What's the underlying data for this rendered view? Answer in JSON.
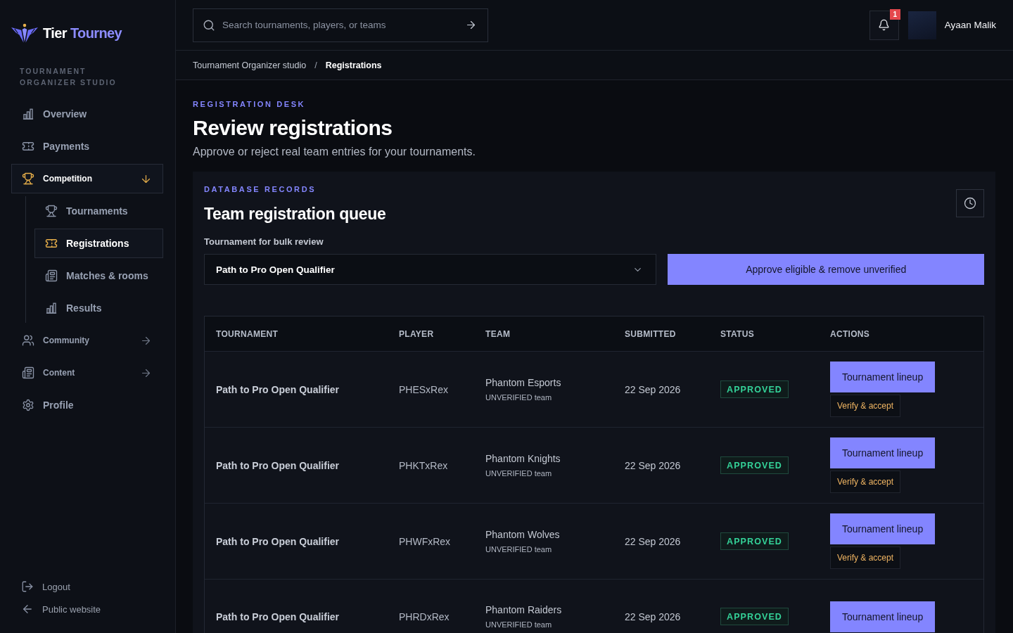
{
  "sidebar": {
    "brand": {
      "name": "Tier",
      "accent": "Tourney"
    },
    "section_label": "TOURNAMENT ORGANIZER STUDIO",
    "nav": [
      {
        "label": "Overview",
        "kind": "link",
        "selected": false
      },
      {
        "label": "Payments",
        "kind": "link",
        "selected": false
      },
      {
        "label": "Competition",
        "kind": "group",
        "selected": true,
        "expanded": true,
        "children": [
          {
            "label": "Tournaments",
            "selected": false
          },
          {
            "label": "Registrations",
            "selected": true
          },
          {
            "label": "Matches & rooms",
            "selected": false
          },
          {
            "label": "Results",
            "selected": false
          }
        ]
      },
      {
        "label": "Community",
        "kind": "group",
        "selected": false,
        "expanded": false
      },
      {
        "label": "Content",
        "kind": "group",
        "selected": false,
        "expanded": false
      },
      {
        "label": "Profile",
        "kind": "link",
        "selected": false
      }
    ],
    "footer_links": [
      {
        "label": "Logout"
      },
      {
        "label": "Public website"
      }
    ]
  },
  "header": {
    "search": {
      "placeholder": "Search tournaments, players, or teams"
    },
    "notifications": {
      "count": "1"
    },
    "user": {
      "name": "Ayaan Malik"
    }
  },
  "breadcrumb": {
    "separator": "/",
    "items": [
      {
        "label": "Tournament Organizer studio",
        "current": false
      },
      {
        "label": "Registrations",
        "current": true
      }
    ]
  },
  "page": {
    "eyebrow": "REGISTRATION DESK",
    "title": "Review registrations",
    "subtitle": "Approve or reject real team entries for your tournaments."
  },
  "queue": {
    "eyebrow": "DATABASE RECORDS",
    "title": "Team registration queue",
    "filter": {
      "label": "Tournament for bulk review",
      "value": "Path to Pro Open Qualifier"
    },
    "bulk_button": "Approve eligible & remove unverified",
    "table": {
      "columns": [
        "TOURNAMENT",
        "PLAYER",
        "TEAM",
        "SUBMITTED",
        "STATUS",
        "ACTIONS"
      ],
      "rows": [
        {
          "tournament": "Path to Pro Open Qualifier",
          "player": "PHESxRex",
          "team": "Phantom Esports",
          "team_note": "UNVERIFIED team",
          "submitted": "22 Sep 2026",
          "status": "APPROVED",
          "actions": [
            {
              "label": "Tournament lineup",
              "kind": "primary"
            },
            {
              "label": "Verify & accept",
              "kind": "secondary"
            }
          ]
        },
        {
          "tournament": "Path to Pro Open Qualifier",
          "player": "PHKTxRex",
          "team": "Phantom Knights",
          "team_note": "UNVERIFIED team",
          "submitted": "22 Sep 2026",
          "status": "APPROVED",
          "actions": [
            {
              "label": "Tournament lineup",
              "kind": "primary"
            },
            {
              "label": "Verify & accept",
              "kind": "secondary"
            }
          ]
        },
        {
          "tournament": "Path to Pro Open Qualifier",
          "player": "PHWFxRex",
          "team": "Phantom Wolves",
          "team_note": "UNVERIFIED team",
          "submitted": "22 Sep 2026",
          "status": "APPROVED",
          "actions": [
            {
              "label": "Tournament lineup",
              "kind": "primary"
            },
            {
              "label": "Verify & accept",
              "kind": "secondary"
            }
          ]
        },
        {
          "tournament": "Path to Pro Open Qualifier",
          "player": "PHRDxRex",
          "team": "Phantom Raiders",
          "team_note": "UNVERIFIED team",
          "submitted": "22 Sep 2026",
          "status": "APPROVED",
          "actions": [
            {
              "label": "Tournament lineup",
              "kind": "primary"
            }
          ]
        }
      ]
    }
  }
}
